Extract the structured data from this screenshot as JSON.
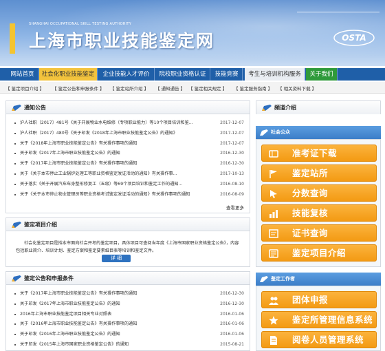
{
  "banner": {
    "en_title": "SHANGHAI OCCUPATIONAL SKILL TESTING AUTHORITY",
    "zh_title": "上海市职业技能鉴定网",
    "logo_text": "OSTA"
  },
  "nav": [
    {
      "label": "网站首页"
    },
    {
      "label": "社会化职业技能鉴定"
    },
    {
      "label": "企业技能人才评价"
    },
    {
      "label": "院校职业资格认证"
    },
    {
      "label": "技能竞赛"
    },
    {
      "label": "考生与培训机构服务"
    },
    {
      "label": "关于我们"
    }
  ],
  "subnav": [
    "鉴定项目介绍",
    "鉴定公告和申报条件",
    "鉴定站所介绍",
    "通知通告",
    "鉴定相关规定",
    "鉴定服务指南",
    "相关资料下载"
  ],
  "notice": {
    "title": "通知公告",
    "items": [
      {
        "text": "沪人社职〔2017〕481号《关于开展物业水电维修（专项职业能力）等10个项目培训和鉴...",
        "date": "2017-12-07"
      },
      {
        "text": "沪人社职〔2017〕480号《关于印发《2018年上海市职业技能鉴定公告》的通知》",
        "date": "2017-12-07"
      },
      {
        "text": "关于《2018年上海市职业技能鉴定公告》有关操作事项的通知",
        "date": "2017-12-07"
      },
      {
        "text": "关于印发《2017年上海市职业技能鉴定公告》的通知",
        "date": "2016-12-30"
      },
      {
        "text": "关于《2017年上海市职业技能鉴定公告》有关操作事项的通知",
        "date": "2016-12-30"
      },
      {
        "text": "关于《关于本市停止工业锅炉处理工等职业资格鉴定发证活动的通知》有关操作事...",
        "date": "2017-10-13"
      },
      {
        "text": "关于落实《关于开展汽车车身整形修复工（五级）等69个项目培训和鉴定工作的通知...",
        "date": "2016-08-10"
      },
      {
        "text": "关于《关于本市停止物业管理员等职业资格考试鉴定发证活动的通知》有关操作事项的通知",
        "date": "2016-08-09"
      }
    ],
    "more": "查看更多"
  },
  "project_intro": {
    "title": "鉴定项目介绍",
    "text": "社会化鉴定项目是指本市面向社会开考的鉴定项目，具体项目可查阅当年度《上海市国家职业资格鉴定公告》，内容包括职业简介、培训计划、鉴定方案和鉴定要素细目表等培训和鉴定文件。",
    "button": "详 细"
  },
  "announce": {
    "title": "鉴定公告和申报条件",
    "items": [
      {
        "text": "关于《2017年上海市职业技能鉴定公告》有关操作事项的通知",
        "date": "2016-12-30"
      },
      {
        "text": "关于印发《2017年上海市职业技能鉴定公告》的通知",
        "date": "2016-12-30"
      },
      {
        "text": "2016年上海市职业技能鉴定项目相关专业对照表",
        "date": "2016-01-06"
      },
      {
        "text": "关于《2016年上海市职业技能鉴定公告》有关操作事项的通知",
        "date": "2016-01-06"
      },
      {
        "text": "关于印发《2016年上海市职业技能鉴定公告》的通知",
        "date": "2016-01-06"
      },
      {
        "text": "关于印发《2015年上海市国家职业资格鉴定公告》的通知",
        "date": "2015-08-21"
      }
    ]
  },
  "right": {
    "channel_title": "频道介绍",
    "public_title": "社会公众",
    "public_buttons": [
      {
        "label": "准考证下载",
        "icon": "ticket-icon"
      },
      {
        "label": "鉴定站所",
        "icon": "flag-icon"
      },
      {
        "label": "分数查询",
        "icon": "cursor-icon"
      },
      {
        "label": "技能复核",
        "icon": "chart-icon"
      },
      {
        "label": "证书查询",
        "icon": "certificate-icon"
      },
      {
        "label": "鉴定项目介绍",
        "icon": "list-icon"
      }
    ],
    "worker_title": "鉴定工作者",
    "worker_buttons": [
      {
        "label": "团体申报",
        "icon": "group-icon"
      },
      {
        "label": "鉴定所管理信息系统",
        "icon": "star-icon"
      },
      {
        "label": "阅卷人员管理系统",
        "icon": "document-icon"
      }
    ]
  },
  "colors": {
    "nav_bg": "#1f5fa8",
    "nav_active": "#f3c33c",
    "nav_green": "#2f9a3a",
    "orange_button": "#f39a13",
    "right_header": "#3c7ec8"
  }
}
